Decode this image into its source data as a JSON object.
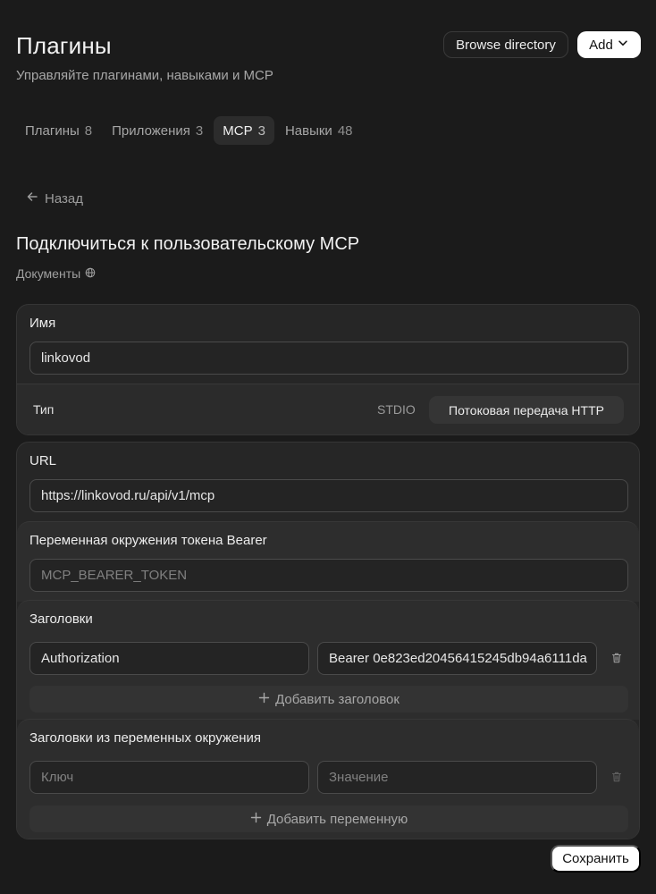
{
  "header": {
    "title": "Плагины",
    "subtitle": "Управляйте плагинами, навыками и MCP",
    "browse_label": "Browse directory",
    "add_label": "Add"
  },
  "tabs": [
    {
      "label": "Плагины",
      "count": "8",
      "active": false
    },
    {
      "label": "Приложения",
      "count": "3",
      "active": false
    },
    {
      "label": "MCP",
      "count": "3",
      "active": true
    },
    {
      "label": "Навыки",
      "count": "48",
      "active": false
    }
  ],
  "back_label": "Назад",
  "page_title": "Подключиться к пользовательскому MCP",
  "docs_label": "Документы",
  "form": {
    "name_label": "Имя",
    "name_value": "linkovod",
    "type_label": "Тип",
    "type_options": [
      "STDIO",
      "Потоковая передача HTTP"
    ],
    "type_selected": "Потоковая передача HTTP",
    "url_label": "URL",
    "url_value": "https://linkovod.ru/api/v1/mcp",
    "bearer_label": "Переменная окружения токена Bearer",
    "bearer_placeholder": "MCP_BEARER_TOKEN",
    "headers_label": "Заголовки",
    "headers": [
      {
        "key": "Authorization",
        "value": "Bearer 0e823ed20456415245db94a6111da"
      }
    ],
    "add_header_label": "Добавить заголовок",
    "env_headers_label": "Заголовки из переменных окружения",
    "env_key_placeholder": "Ключ",
    "env_value_placeholder": "Значение",
    "add_variable_label": "Добавить переменную"
  },
  "save_label": "Сохранить",
  "icons": {
    "chevron": "chevron-down-icon",
    "back": "arrow-left-icon",
    "globe": "globe-icon",
    "plus": "plus-icon",
    "trash": "trash-icon"
  }
}
